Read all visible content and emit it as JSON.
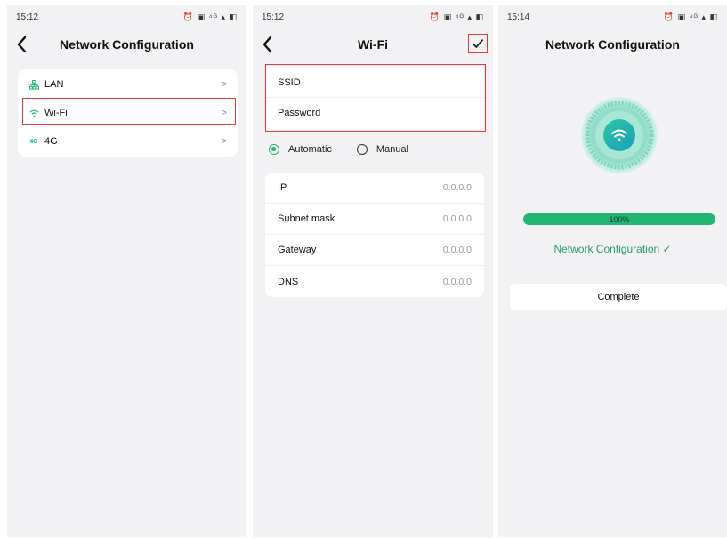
{
  "panel1": {
    "status": {
      "time": "15:12",
      "icons": "⏰ ▣ ⁴ᴳ ▴ ◧"
    },
    "title": "Network Configuration",
    "items": [
      {
        "label": "LAN",
        "icon": "lan-icon",
        "chevron": ">"
      },
      {
        "label": "Wi-Fi",
        "icon": "wifi-icon",
        "chevron": ">"
      },
      {
        "label": "4G",
        "icon": "4g-icon",
        "icon_text": "4G",
        "chevron": ">"
      }
    ]
  },
  "panel2": {
    "status": {
      "time": "15:12",
      "icons": "⏰ ▣ ⁴ᴳ ▴ ◧"
    },
    "title": "Wi-Fi",
    "ssid_label": "SSID",
    "password_label": "Password",
    "radio_automatic": "Automatic",
    "radio_manual": "Manual",
    "network": [
      {
        "label": "IP",
        "value": "0.0.0.0"
      },
      {
        "label": "Subnet mask",
        "value": "0.0.0.0"
      },
      {
        "label": "Gateway",
        "value": "0.0.0.0"
      },
      {
        "label": "DNS",
        "value": "0.0.0.0"
      }
    ]
  },
  "panel3": {
    "status": {
      "time": "15:14",
      "icons": "⏰ ▣ ⁴ᴳ ▴ ◧"
    },
    "title": "Network Configuration",
    "progress_text": "100%",
    "progress_value": 100,
    "status_text": "Network Configuration ✓",
    "complete_label": "Complete"
  },
  "colors": {
    "accent": "#22b573",
    "highlight": "#e53935"
  }
}
